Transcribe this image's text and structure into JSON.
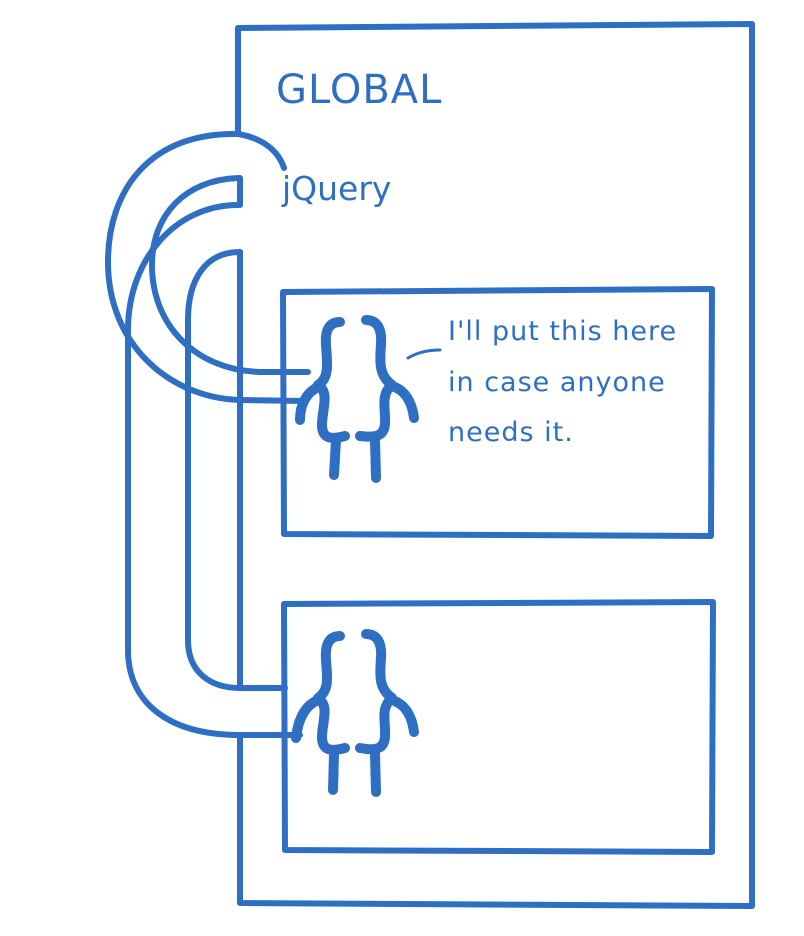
{
  "diagram": {
    "title": "GLOBAL",
    "variable": "jQuery",
    "note_lines": [
      "I'll put this here",
      "in case anyone",
      "needs it."
    ],
    "ink_color": "#2e6fc4"
  }
}
